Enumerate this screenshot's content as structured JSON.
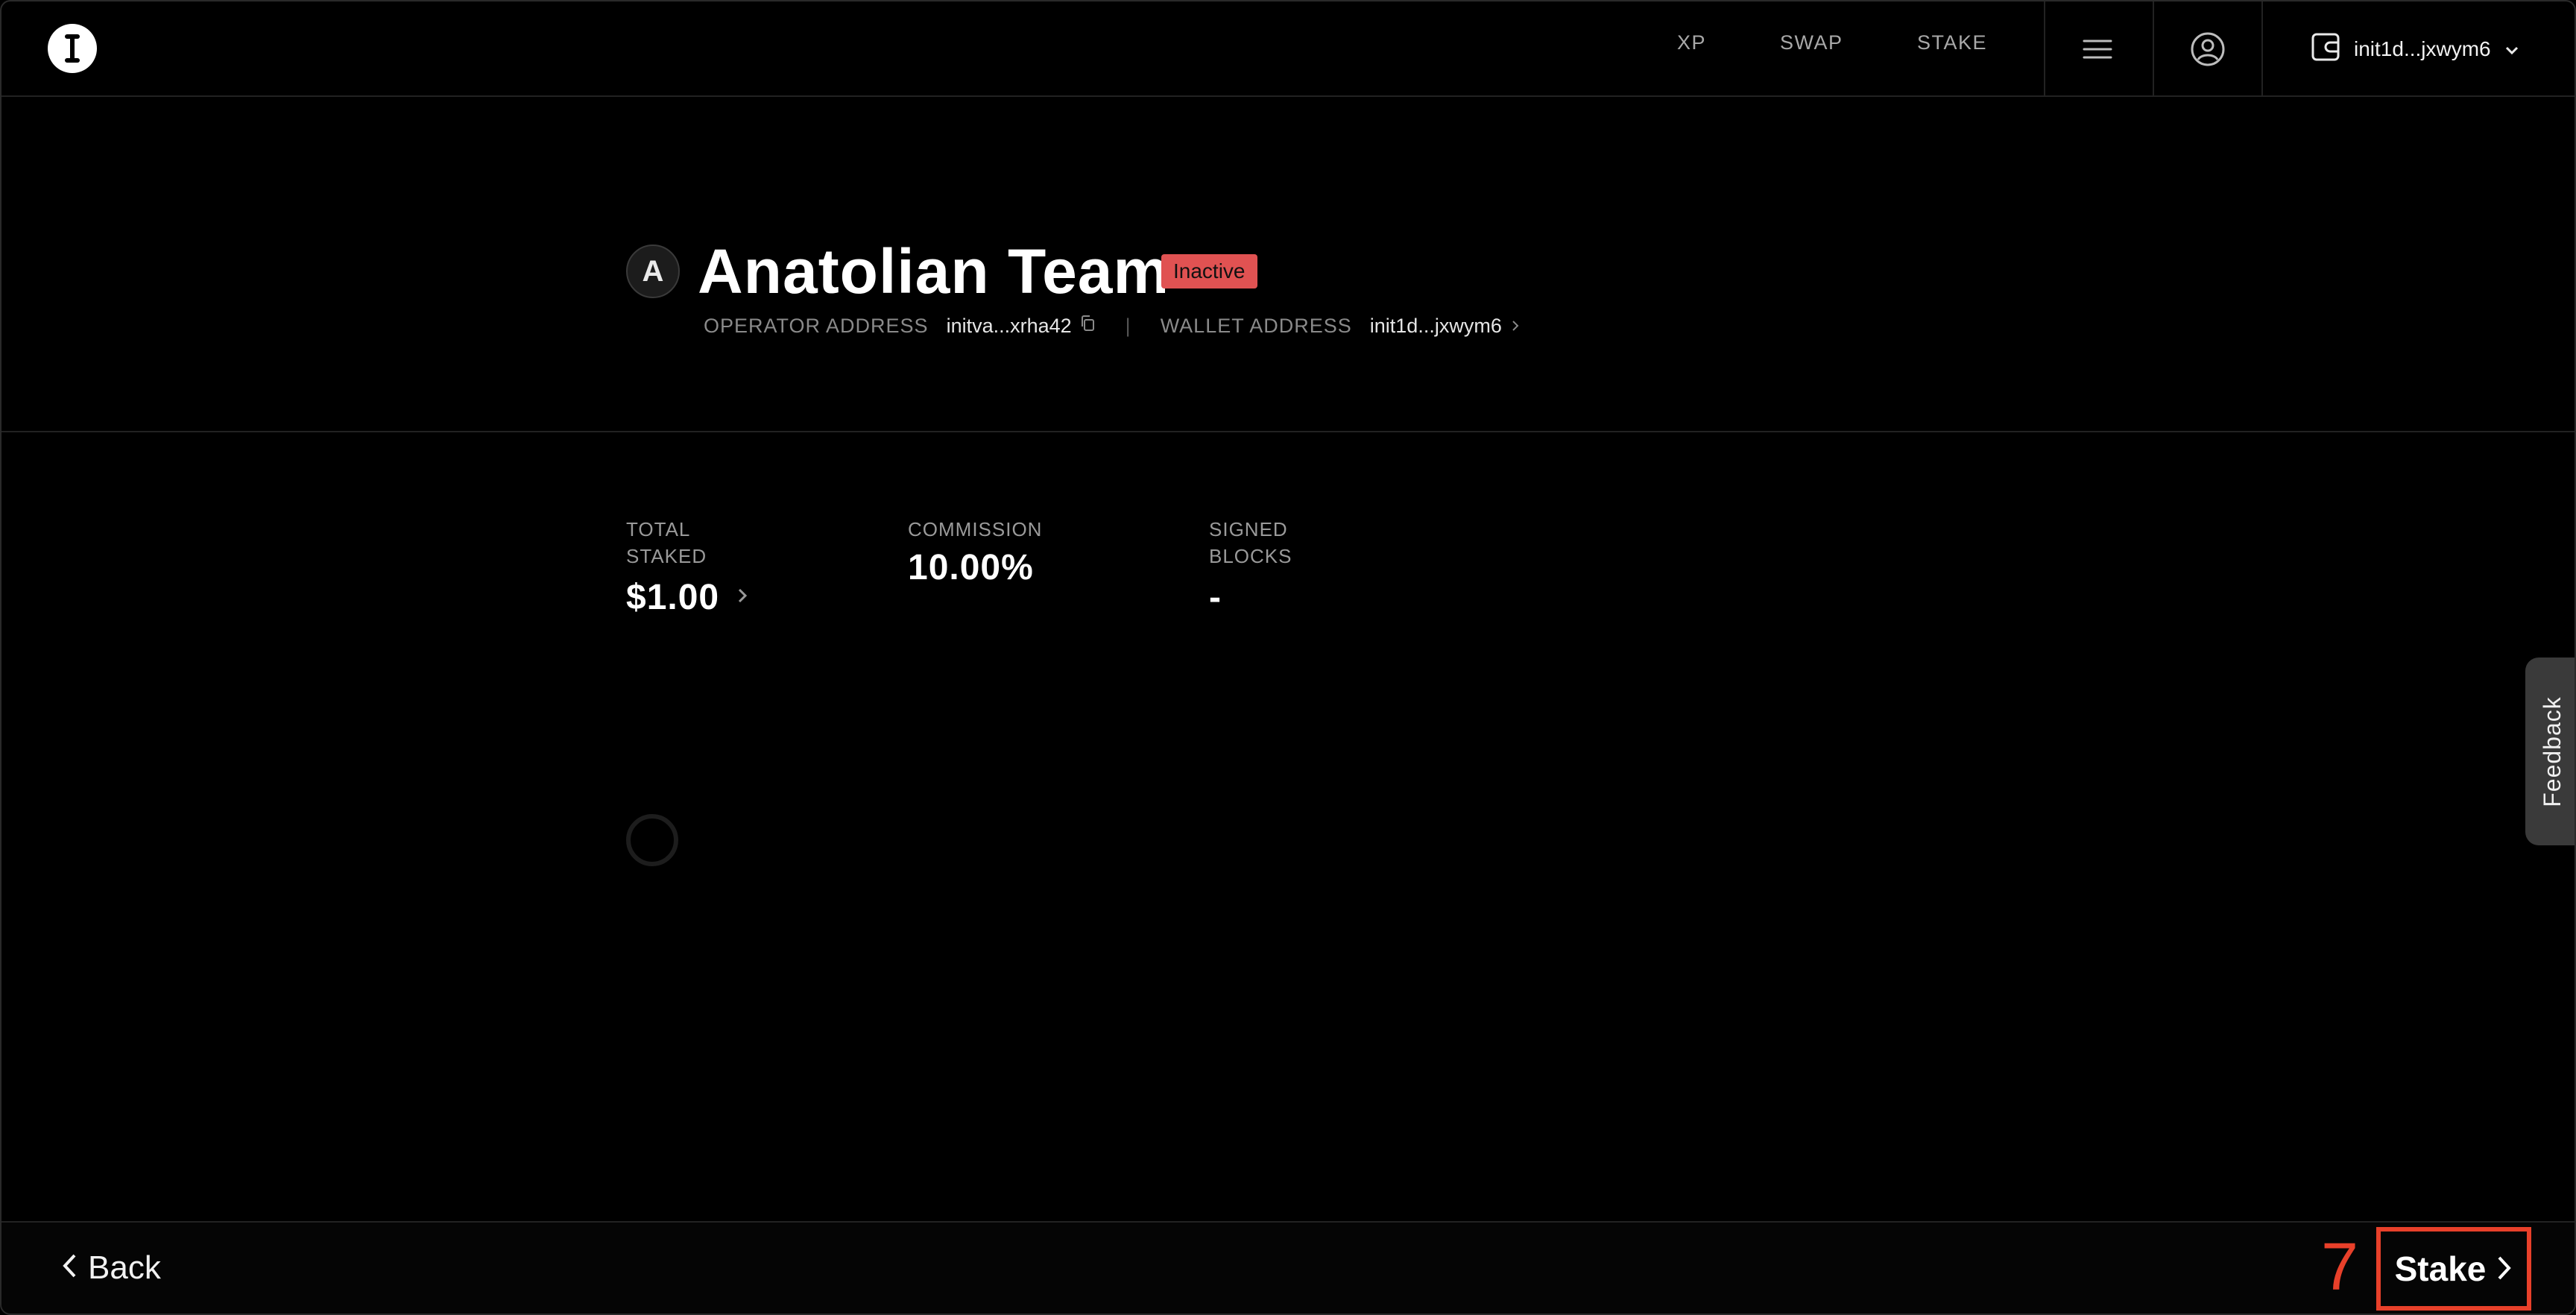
{
  "header": {
    "nav": [
      "XP",
      "SWAP",
      "STAKE"
    ],
    "wallet_label": "init1d...jxwym6"
  },
  "validator": {
    "avatar_letter": "A",
    "name": "Anatolian Team",
    "status": "Inactive",
    "operator_label": "OPERATOR ADDRESS",
    "operator_value": "initva...xrha42",
    "wallet_label": "WALLET ADDRESS",
    "wallet_value": "init1d...jxwym6"
  },
  "stats": {
    "total_staked_label_1": "TOTAL",
    "total_staked_label_2": "STAKED",
    "total_staked_value": "$1.00",
    "commission_label": "COMMISSION",
    "commission_value": "10.00%",
    "signed_label_1": "SIGNED",
    "signed_label_2": "BLOCKS",
    "signed_value": "-"
  },
  "feedback_label": "Feedback",
  "footer": {
    "back_label": "Back",
    "step_number": "7",
    "stake_label": "Stake"
  },
  "colors": {
    "status_inactive": "#e05252",
    "highlight": "#e8402a"
  }
}
